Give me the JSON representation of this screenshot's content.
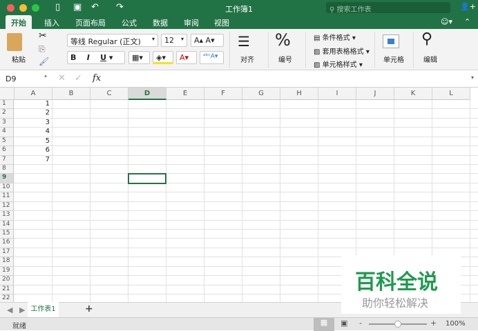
{
  "window": {
    "title": "工作簿1",
    "search_placeholder": "搜索工作表"
  },
  "tabs": [
    "开始",
    "插入",
    "页面布局",
    "公式",
    "数据",
    "审阅",
    "视图"
  ],
  "ribbon": {
    "paste": "粘贴",
    "font_name": "等线 Regular (正文)",
    "font_size": "12",
    "bold": "B",
    "italic": "I",
    "underline": "U",
    "align": "对齐",
    "number": "编号",
    "number_symbol": "%",
    "conditional_format": "条件格式",
    "table_format": "套用表格格式",
    "cell_style": "单元格样式",
    "cells": "单元格",
    "edit": "编辑"
  },
  "formula_bar": {
    "name_box": "D9",
    "fx": "fx",
    "value": ""
  },
  "columns": [
    "A",
    "B",
    "C",
    "D",
    "E",
    "F",
    "G",
    "H",
    "I",
    "J",
    "K",
    "L"
  ],
  "rows": 22,
  "cells": {
    "A": [
      "1",
      "2",
      "3",
      "4",
      "5",
      "6",
      "7"
    ]
  },
  "selected_cell": "D9",
  "sheet_tabs": [
    "工作表1"
  ],
  "add_sheet": "+",
  "status": {
    "ready": "就绪",
    "zoom": "100%",
    "zoom_fraction": 0.5
  },
  "watermark": {
    "brand": "百科全说",
    "slogan": "助你轻松解决"
  },
  "colors": {
    "accent": "#217346"
  }
}
